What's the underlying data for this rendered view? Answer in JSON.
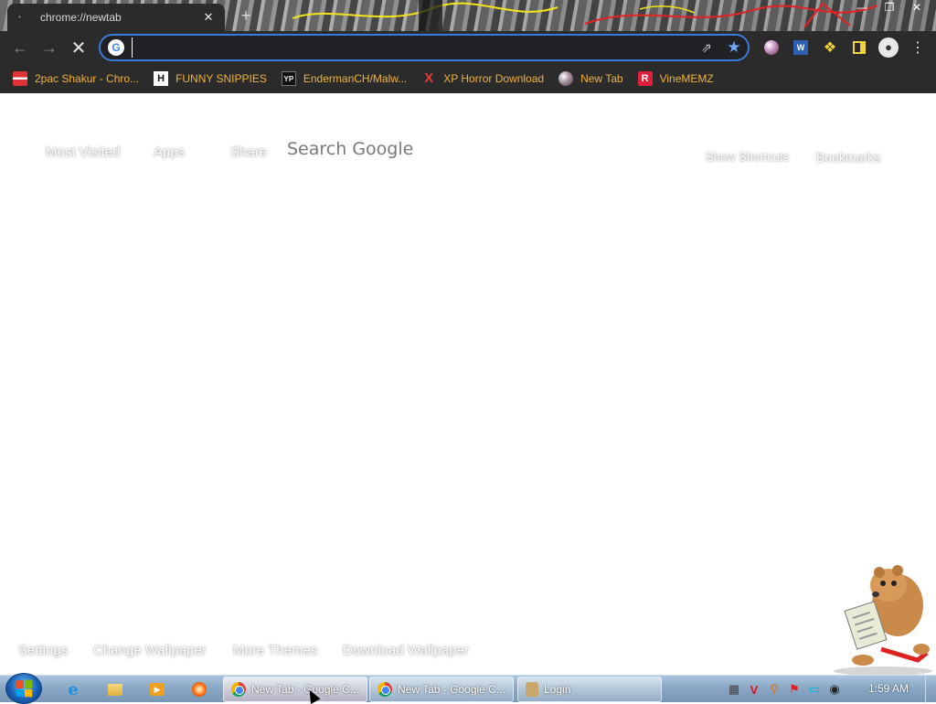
{
  "browser": {
    "tab_title": "chrome://newtab",
    "tab_close": "✕",
    "new_tab": "+",
    "window_controls": [
      "—",
      "❐",
      "✕"
    ],
    "address_value": "",
    "omnibox_badge": "G",
    "icons": [
      "back-icon",
      "forward-icon",
      "stop-icon",
      "share-icon",
      "bookmark-star-icon",
      "extension-puzzle-icon",
      "side-panel-icon",
      "profile-icon",
      "menu-icon"
    ],
    "accent_color": "#3a7bd5"
  },
  "bookmarks": [
    {
      "label": "2pac Shakur - Chro...",
      "icon": "gift-icon",
      "badge": ""
    },
    {
      "label": "FUNNY SNIPPIES",
      "icon": "h-icon",
      "badge": "H"
    },
    {
      "label": "EndermanCH/Malw...",
      "icon": "yp-icon",
      "badge": "YP"
    },
    {
      "label": "XP Horror Download",
      "icon": "x-icon",
      "badge": "X"
    },
    {
      "label": "New Tab",
      "icon": "globe-icon",
      "badge": ""
    },
    {
      "label": "VineMEMZ",
      "icon": "r-icon",
      "badge": "R"
    }
  ],
  "newtab": {
    "top_links": [
      "Most Visited",
      "Apps",
      "Share"
    ],
    "search_label": "Search Google",
    "right_links": [
      "Show Shortcuts",
      "Bookmarks"
    ],
    "bottom_links": [
      "Settings",
      "Change Wallpaper",
      "More Themes",
      "Download Wallpaper"
    ]
  },
  "taskbar": {
    "pinned": [
      "internet-explorer-icon",
      "folder-icon",
      "media-player-icon",
      "app-icon"
    ],
    "ie_glyph": "e",
    "media_glyph": "▶",
    "windows": [
      {
        "label": "New Tab - Google C...",
        "icon": "chrome-icon",
        "active": true
      },
      {
        "label": "New Tab - Google C...",
        "icon": "chrome-icon",
        "active": false
      },
      {
        "label": "Login",
        "icon": "login-icon",
        "active": false
      }
    ],
    "tray_glyphs": [
      "▦",
      "V",
      "⚲",
      "⚑",
      "▭",
      "◉"
    ],
    "clock": "1:59 AM"
  }
}
